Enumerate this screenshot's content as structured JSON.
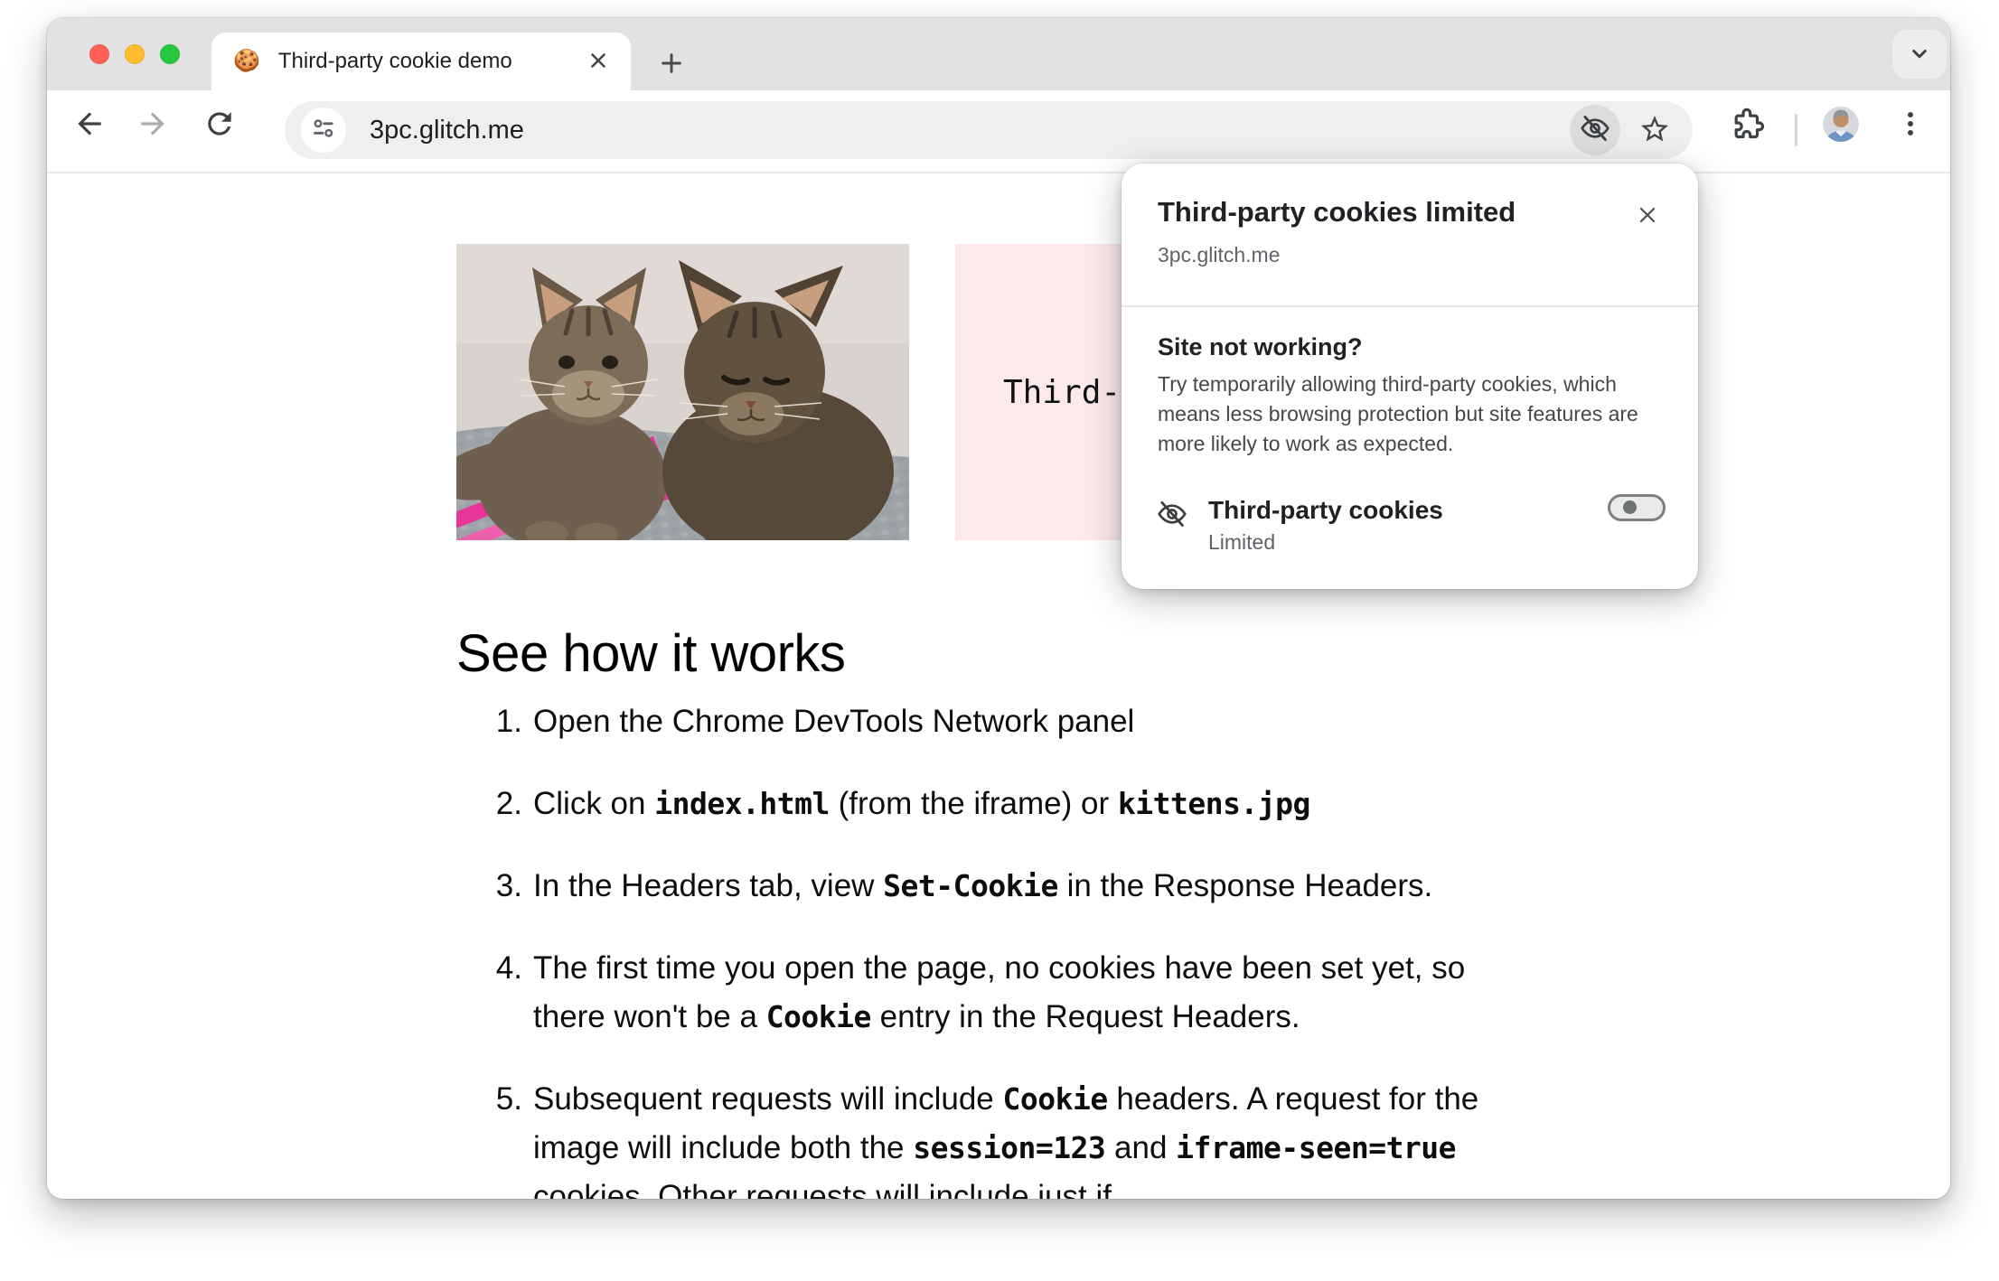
{
  "browser": {
    "tab": {
      "favicon": "🍪",
      "title": "Third-party cookie demo"
    },
    "url": "3pc.glitch.me"
  },
  "popup": {
    "title": "Third-party cookies limited",
    "site": "3pc.glitch.me",
    "section_title": "Site not working?",
    "section_body": "Try temporarily allowing third-party cookies, which\nmeans less browsing protection but site features are\nmore likely to work as expected.",
    "setting_label": "Third-party cookies",
    "setting_status": "Limited",
    "toggle_state": "off"
  },
  "page": {
    "iframe_text": "Third-",
    "heading": "See how it works",
    "steps": [
      {
        "num": "1.",
        "segments": [
          {
            "t": "Open the Chrome DevTools Network panel"
          }
        ]
      },
      {
        "num": "2.",
        "segments": [
          {
            "t": "Click on "
          },
          {
            "c": "index.html"
          },
          {
            "t": " (from the iframe) or "
          },
          {
            "c": "kittens.jpg"
          }
        ]
      },
      {
        "num": "3.",
        "segments": [
          {
            "t": "In the Headers tab, view "
          },
          {
            "c": "Set-Cookie"
          },
          {
            "t": " in the Response Headers."
          }
        ]
      },
      {
        "num": "4.",
        "segments": [
          {
            "t": "The first time you open the page, no cookies have been set yet, so\nthere won't be a "
          },
          {
            "c": "Cookie"
          },
          {
            "t": " entry in the Request Headers."
          }
        ]
      },
      {
        "num": "5.",
        "segments": [
          {
            "t": "Subsequent requests will include "
          },
          {
            "c": "Cookie"
          },
          {
            "t": " headers. A request for the\nimage will include both the "
          },
          {
            "c": "session=123"
          },
          {
            "t": " and "
          },
          {
            "c": "iframe-seen=true"
          },
          {
            "t": "\ncookies. Other requests will include just if"
          }
        ]
      }
    ]
  },
  "colors": {
    "tabstrip": "#E2E2E2",
    "omnibox": "#EFEFEF",
    "iframe_pink": "#FCE9EB",
    "traffic_close": "#FF5F57",
    "traffic_min": "#FEBC2E",
    "traffic_zoom": "#28C840"
  }
}
